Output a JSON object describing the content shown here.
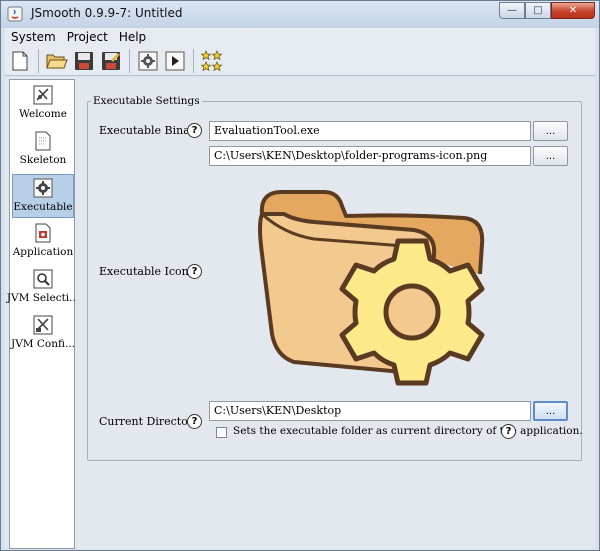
{
  "window": {
    "title": "JSmooth 0.9.9-7: Untitled",
    "controls": {
      "minimize": "—",
      "maximize": "□",
      "close": "✕"
    }
  },
  "menu": [
    "System",
    "Project",
    "Help"
  ],
  "toolbar": {
    "icons": [
      "new-file-icon",
      "open-folder-icon",
      "save-icon",
      "save-as-icon",
      "compile-gear-icon",
      "run-icon",
      "stars-icon"
    ]
  },
  "sidebar": {
    "items": [
      {
        "label": "Welcome",
        "icon": "welcome-icon",
        "selected": false
      },
      {
        "label": "Skeleton",
        "icon": "skeleton-icon",
        "selected": false
      },
      {
        "label": "Executable",
        "icon": "executable-gear-icon",
        "selected": true
      },
      {
        "label": "Application",
        "icon": "application-icon",
        "selected": false
      },
      {
        "label": "JVM Selecti...",
        "icon": "jvm-selection-icon",
        "selected": false
      },
      {
        "label": "JVM Confi...",
        "icon": "jvm-config-icon",
        "selected": false
      }
    ]
  },
  "executable_settings": {
    "legend": "Executable Settings",
    "binary_label": "Executable Binary",
    "binary_value": "EvaluationTool.exe",
    "icon_path_value": "C:\\Users\\KEN\\Desktop\\folder-programs-icon.png",
    "icon_label": "Executable Icon",
    "icon_preview": "folder-gear-icon",
    "directory_label": "Current Directory",
    "directory_value": "C:\\Users\\KEN\\Desktop",
    "checkbox_label": "Sets the executable folder as current directory of the application.",
    "checkbox_checked": false,
    "browse_label": "...",
    "help_label": "?"
  },
  "colors": {
    "folder_fill": "#f3c98f",
    "folder_back": "#e4a860",
    "gear_fill": "#fbe98a",
    "outline": "#5b3a22",
    "selection": "#b8cfe8"
  }
}
